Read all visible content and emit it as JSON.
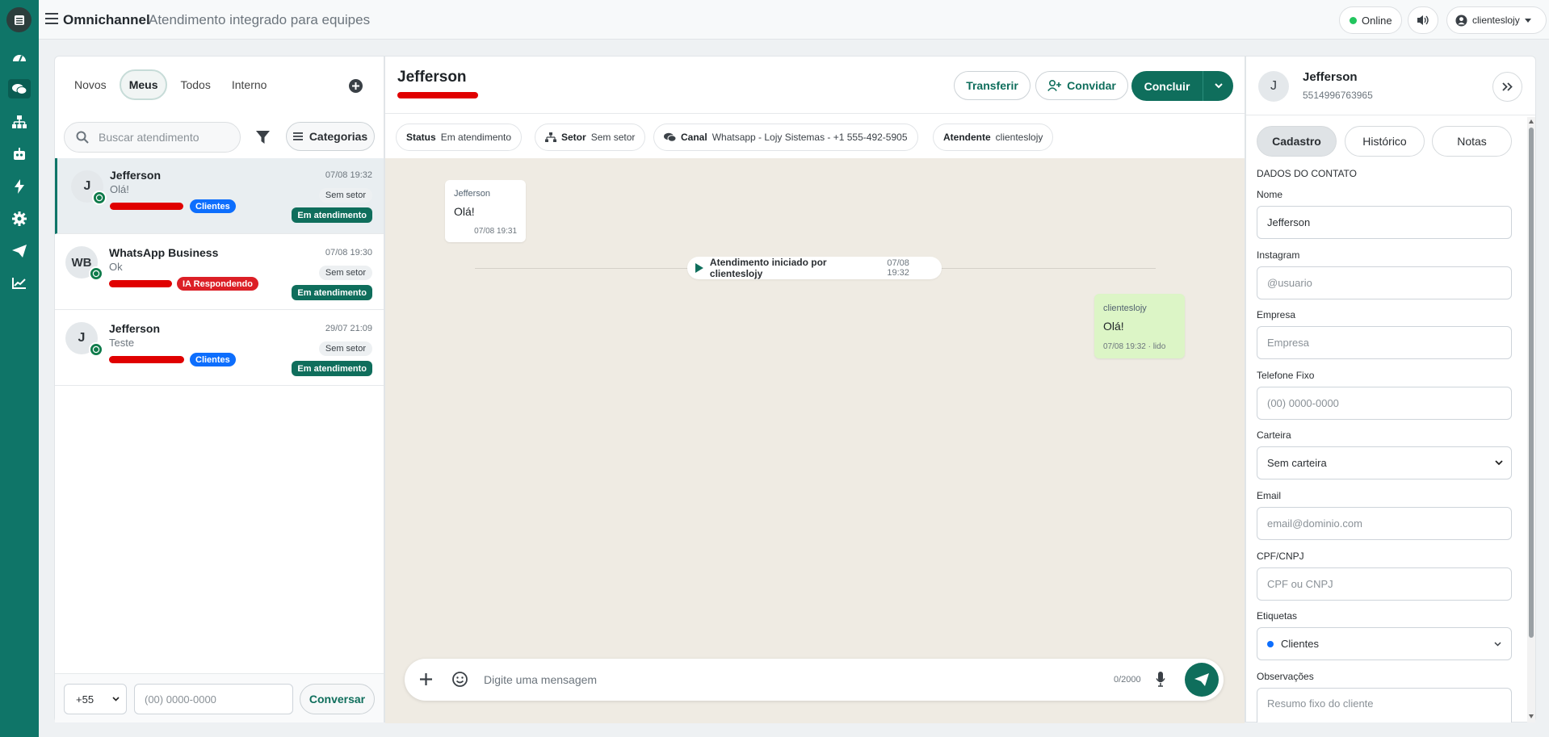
{
  "header": {
    "brand": "Omnichannel",
    "subtitle": "Atendimento integrado para equipes",
    "status": "Online",
    "user": "clienteslojy"
  },
  "left": {
    "tabs": [
      "Novos",
      "Meus",
      "Todos",
      "Interno"
    ],
    "search_placeholder": "Buscar atendimento",
    "categories_label": "Categorias",
    "conversations": [
      {
        "initials": "J",
        "name": "Jefferson",
        "message": "Olá!",
        "time": "07/08 19:32",
        "tag": "Clientes",
        "sector": "Sem setor",
        "status": "Em atendimento"
      },
      {
        "initials": "WB",
        "name": "WhatsApp Business",
        "message": "Ok",
        "time": "07/08 19:30",
        "tag": "IA Respondendo",
        "sector": "Sem setor",
        "status": "Em atendimento"
      },
      {
        "initials": "J",
        "name": "Jefferson",
        "message": "Teste",
        "time": "29/07 21:09",
        "tag": "Clientes",
        "sector": "Sem setor",
        "status": "Em atendimento"
      }
    ],
    "country_code": "+55",
    "phone_placeholder": "(00) 0000-0000",
    "start_label": "Conversar"
  },
  "chat": {
    "title": "Jefferson",
    "transfer": "Transferir",
    "invite": "Convidar",
    "finish": "Concluir",
    "chips": {
      "status_label": "Status",
      "status_value": "Em atendimento",
      "sector_label": "Setor",
      "sector_value": "Sem setor",
      "channel_label": "Canal",
      "channel_value": "Whatsapp - Lojy Sistemas - +1 555-492-5905",
      "agent_label": "Atendente",
      "agent_value": "clienteslojy"
    },
    "messages": [
      {
        "sender": "Jefferson",
        "text": "Olá!",
        "meta": "07/08 19:31"
      },
      {
        "sender": "clienteslojy",
        "text": "Olá!",
        "meta": "07/08 19:32 · lido"
      }
    ],
    "system_event": "Atendimento iniciado por clienteslojy",
    "system_time": "07/08 19:32",
    "composer_placeholder": "Digite uma mensagem",
    "char_count": "0/2000"
  },
  "contact": {
    "initials": "J",
    "name": "Jefferson",
    "phone": "5514996763965",
    "tabs": [
      "Cadastro",
      "Histórico",
      "Notas"
    ],
    "section": "DADOS DO CONTATO",
    "fields": [
      {
        "label": "Nome",
        "value": "Jefferson",
        "placeholder": ""
      },
      {
        "label": "Instagram",
        "value": "",
        "placeholder": "@usuario"
      },
      {
        "label": "Empresa",
        "value": "",
        "placeholder": "Empresa"
      },
      {
        "label": "Telefone Fixo",
        "value": "",
        "placeholder": "(00) 0000-0000"
      },
      {
        "label": "Carteira",
        "value": "Sem carteira",
        "placeholder": ""
      },
      {
        "label": "Email",
        "value": "",
        "placeholder": "email@dominio.com"
      },
      {
        "label": "CPF/CNPJ",
        "value": "",
        "placeholder": "CPF ou CNPJ"
      },
      {
        "label": "Etiquetas",
        "value": "Clientes",
        "placeholder": ""
      },
      {
        "label": "Observações",
        "value": "",
        "placeholder": "Resumo fixo do cliente"
      }
    ]
  },
  "colors": {
    "brand": "#0f7568",
    "accent_dark": "#0f6e5c",
    "tag_blue": "#0d6efd",
    "tag_red": "#dc1f26",
    "redact": "#e00000"
  }
}
